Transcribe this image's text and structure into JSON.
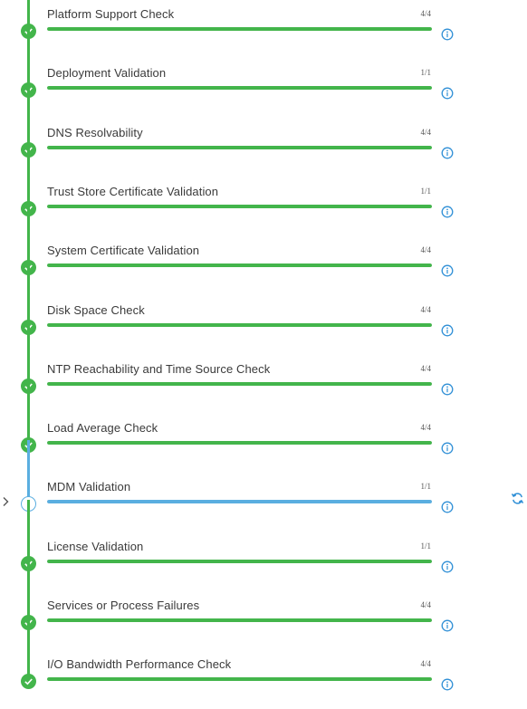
{
  "checks": [
    {
      "name": "Platform Support Check",
      "count": "4/4",
      "status": "passed",
      "progress": 1.0
    },
    {
      "name": "Deployment Validation",
      "count": "1/1",
      "status": "passed",
      "progress": 1.0
    },
    {
      "name": "DNS Resolvability",
      "count": "4/4",
      "status": "passed",
      "progress": 1.0
    },
    {
      "name": "Trust Store Certificate Validation",
      "count": "1/1",
      "status": "passed",
      "progress": 1.0
    },
    {
      "name": "System Certificate Validation",
      "count": "4/4",
      "status": "passed",
      "progress": 1.0
    },
    {
      "name": "Disk Space Check",
      "count": "4/4",
      "status": "passed",
      "progress": 1.0
    },
    {
      "name": "NTP Reachability and Time Source Check",
      "count": "4/4",
      "status": "passed",
      "progress": 1.0
    },
    {
      "name": "Load Average Check",
      "count": "4/4",
      "status": "passed",
      "progress": 1.0
    },
    {
      "name": "MDM Validation",
      "count": "1/1",
      "status": "in-progress",
      "progress": 1.0
    },
    {
      "name": "License Validation",
      "count": "1/1",
      "status": "passed",
      "progress": 1.0
    },
    {
      "name": "Services or Process Failures",
      "count": "4/4",
      "status": "passed",
      "progress": 1.0
    },
    {
      "name": "I/O Bandwidth Performance Check",
      "count": "4/4",
      "status": "passed",
      "progress": 1.0
    }
  ],
  "colors": {
    "passed": "#43b54b",
    "in_progress": "#5aaee0",
    "info": "#2f8fd6",
    "track": "#e4e4e4"
  },
  "icons": {
    "passed": "check-icon",
    "in_progress": "info-icon",
    "info": "info-icon",
    "expand": "chevron-right-icon",
    "refresh": "refresh-icon"
  }
}
